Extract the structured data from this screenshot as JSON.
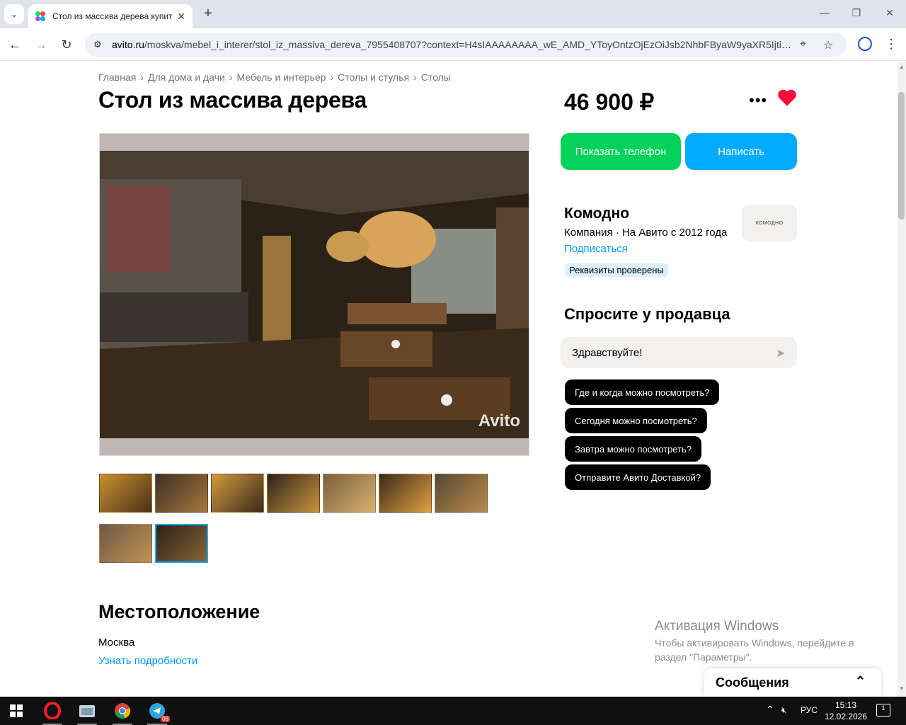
{
  "browser": {
    "tab_title": "Стол из массива дерева купить",
    "url_domain": "avito.ru",
    "url_path": "/moskva/mebel_i_interer/stol_iz_massiva_dereva_7955408707?context=H4sIAAAAAAAA_wE_AMD_YToyOntzOjEzOiJsb2NhbFByaW9yaXR5IjtiOjA7cz..."
  },
  "breadcrumb": [
    "Главная",
    "Для дома и дачи",
    "Мебель и интерьер",
    "Столы и стулья",
    "Столы"
  ],
  "listing": {
    "title": "Стол из массива дерева",
    "price": "46 900 ₽",
    "watermark": "Avito"
  },
  "actions": {
    "phone_button": "Показать телефон",
    "write_button": "Написать"
  },
  "seller": {
    "name": "Комодно",
    "meta": "Компания · На Авито с 2012 года",
    "subscribe": "Подписаться",
    "verified_badge": "Реквизиты проверены",
    "logo_text": "КОМОДНО"
  },
  "ask": {
    "title": "Спросите у продавца",
    "input_value": "Здравствуйте!",
    "quick_questions": [
      "Где и когда можно посмотреть?",
      "Сегодня можно посмотреть?",
      "Завтра можно посмотреть?",
      "Отправите Авито Доставкой?"
    ]
  },
  "location": {
    "title": "Местоположение",
    "city": "Москва",
    "more_link": "Узнать подробности"
  },
  "windows_activation": {
    "title": "Активация Windows",
    "text": "Чтобы активировать Windows, перейдите в раздел \"Параметры\"."
  },
  "messages_panel": {
    "label": "Сообщения"
  },
  "taskbar": {
    "language": "РУС",
    "time": "15:13",
    "date": "12.02.2026",
    "telegram_badge": "08",
    "notification_count": "1"
  },
  "colors": {
    "phone_button": "#02d15c",
    "write_button": "#00aaff",
    "link": "#0099f7",
    "heart": "#ff0a3c"
  }
}
